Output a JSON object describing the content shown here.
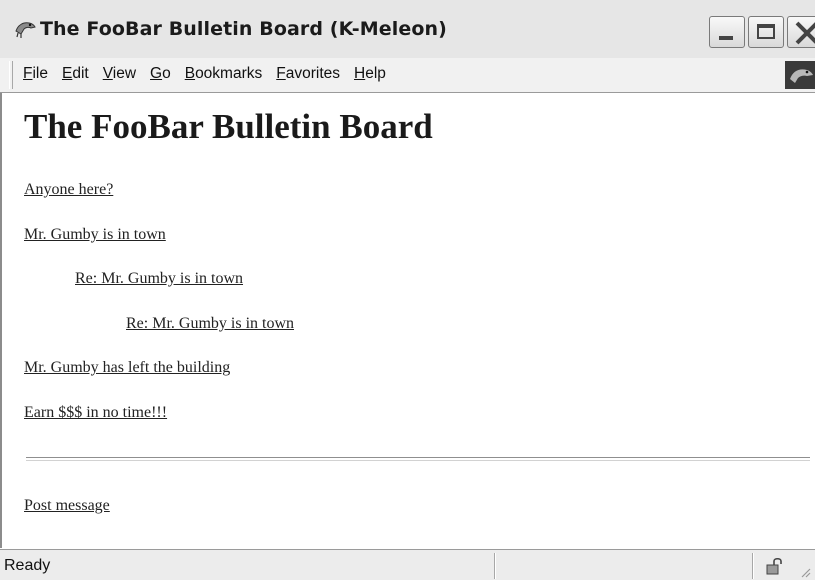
{
  "window": {
    "title": "The FooBar Bulletin Board (K-Meleon)",
    "app_icon": "kmeleon-lizard-icon",
    "controls": [
      "minimize-icon",
      "maximize-icon",
      "close-icon"
    ]
  },
  "menu": {
    "items": [
      {
        "pre": "",
        "acc": "F",
        "post": "ile"
      },
      {
        "pre": "",
        "acc": "E",
        "post": "dit"
      },
      {
        "pre": "",
        "acc": "V",
        "post": "iew"
      },
      {
        "pre": "",
        "acc": "G",
        "post": "o"
      },
      {
        "pre": "",
        "acc": "B",
        "post": "ookmarks"
      },
      {
        "pre": "",
        "acc": "F",
        "post": "avorites"
      },
      {
        "pre": "",
        "acc": "H",
        "post": "elp"
      }
    ],
    "throbber_icon": "kmeleon-throbber-icon"
  },
  "page": {
    "heading": "The FooBar Bulletin Board",
    "posts": [
      {
        "text": "Anyone here?",
        "level": 0
      },
      {
        "text": "Mr. Gumby is in town",
        "level": 0
      },
      {
        "text": "Re: Mr. Gumby is in town",
        "level": 1
      },
      {
        "text": "Re: Mr. Gumby is in town",
        "level": 2
      },
      {
        "text": "Mr. Gumby has left the building",
        "level": 0
      },
      {
        "text": "Earn $$$ in no time!!!",
        "level": 0
      }
    ],
    "post_message": "Post message"
  },
  "status": {
    "text": "Ready",
    "security_icon": "unlocked-padlock-icon"
  },
  "colors": {
    "titlebar": "#e6e6e6",
    "menubar": "#f1f1f1",
    "link": "#222222",
    "background": "#ffffff"
  }
}
